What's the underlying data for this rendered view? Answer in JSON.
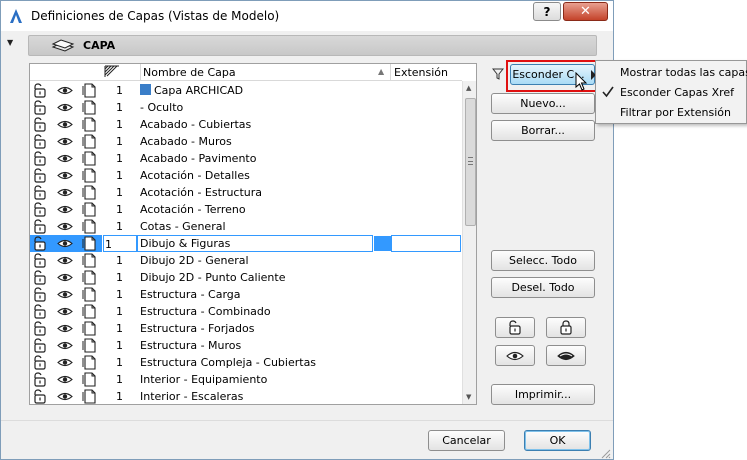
{
  "window": {
    "title": "Definiciones de Capas (Vistas de Modelo)",
    "help_label": "?",
    "close_label": "✕"
  },
  "section": {
    "title": "CAPA"
  },
  "table": {
    "col_name": "Nombre de Capa",
    "col_ext": "Extensión",
    "rows": [
      {
        "num": "1",
        "name": "Capa ARCHICAD"
      },
      {
        "num": "1",
        "name": "- Oculto"
      },
      {
        "num": "1",
        "name": "Acabado - Cubiertas"
      },
      {
        "num": "1",
        "name": "Acabado - Muros"
      },
      {
        "num": "1",
        "name": "Acabado - Pavimento"
      },
      {
        "num": "1",
        "name": "Acotación - Detalles"
      },
      {
        "num": "1",
        "name": "Acotación - Estructura"
      },
      {
        "num": "1",
        "name": "Acotación - Terreno"
      },
      {
        "num": "1",
        "name": "Cotas - General"
      },
      {
        "num": "1",
        "name": "Dibujo & Figuras"
      },
      {
        "num": "1",
        "name": "Dibujo 2D - General"
      },
      {
        "num": "1",
        "name": "Dibujo 2D - Punto Caliente"
      },
      {
        "num": "1",
        "name": "Estructura - Carga"
      },
      {
        "num": "1",
        "name": "Estructura - Combinado"
      },
      {
        "num": "1",
        "name": "Estructura - Forjados"
      },
      {
        "num": "1",
        "name": "Estructura - Muros"
      },
      {
        "num": "1",
        "name": "Estructura Compleja - Cubiertas"
      },
      {
        "num": "1",
        "name": "Interior - Equipamiento"
      },
      {
        "num": "1",
        "name": "Interior - Escaleras"
      }
    ],
    "selected_index": 9
  },
  "buttons": {
    "hide": "Esconder C...",
    "new": "Nuevo...",
    "delete": "Borrar...",
    "select_all": "Selecc. Todo",
    "deselect_all": "Desel. Todo",
    "print": "Imprimir...",
    "cancel": "Cancelar",
    "ok": "OK"
  },
  "popup": {
    "items": [
      {
        "label": "Mostrar todas las capas",
        "checked": false
      },
      {
        "label": "Esconder Capas Xref",
        "checked": true
      },
      {
        "label": "Filtrar por Extensión",
        "checked": false
      }
    ]
  },
  "icons": {
    "lock": "unlocked-padlock-icon",
    "eye": "eye-icon",
    "page": "layer-page-icon"
  },
  "colors": {
    "selection": "#3399ff",
    "highlight_box": "#e01010",
    "active_button": "#a9dbf6"
  }
}
